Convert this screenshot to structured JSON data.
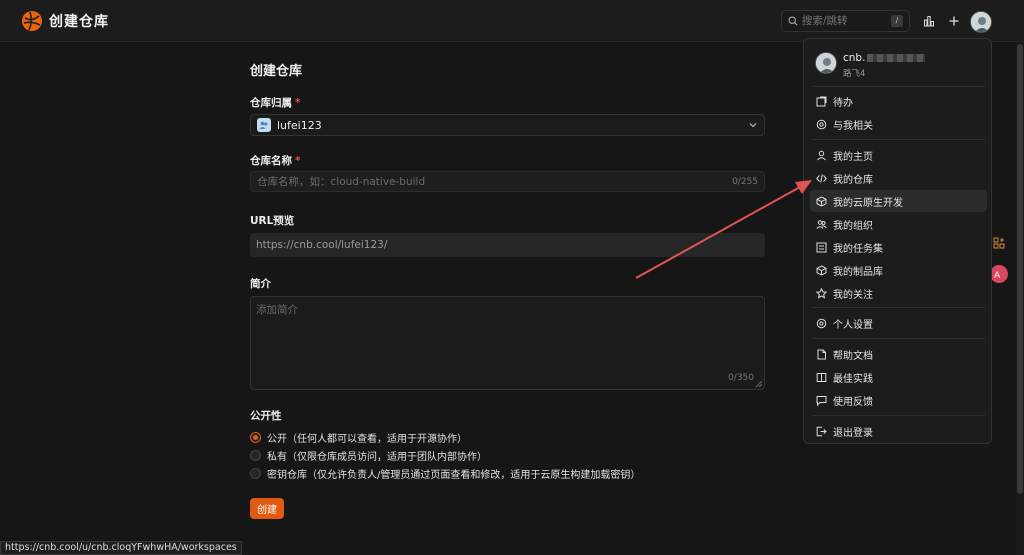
{
  "topbar": {
    "app_title": "创建仓库",
    "search_placeholder": "搜索/跳转",
    "search_shortcut": "/"
  },
  "form": {
    "page_title": "创建仓库",
    "owner_label": "仓库归属",
    "owner_value": "lufei123",
    "name_label": "仓库名称",
    "name_placeholder": "仓库名称，如：cloud-native-build",
    "name_counter": "0/255",
    "url_label": "URL预览",
    "url_value": "https://cnb.cool/lufei123/",
    "desc_label": "简介",
    "desc_placeholder": "添加简介",
    "desc_counter": "0/350",
    "visibility_label": "公开性",
    "visibility_options": [
      {
        "label": "公开（任何人都可以查看，适用于开源协作）",
        "checked": true
      },
      {
        "label": "私有（仅限仓库成员访问，适用于团队内部协作）",
        "checked": false
      },
      {
        "label": "密钥仓库（仅允许负责人/管理员通过页面查看和修改，适用于云原生构建加载密钥）",
        "checked": false
      }
    ],
    "create_button": "创建",
    "required_mark": "*"
  },
  "status_url": "https://cnb.cool/u/cnb.cloqYFwhwHA/workspaces",
  "menu": {
    "user_name": "cnb.",
    "user_sub": "路飞4",
    "items": [
      {
        "label": "待办",
        "icon": "todo-icon"
      },
      {
        "label": "与我相关",
        "icon": "at-icon"
      },
      {
        "label": "我的主页",
        "icon": "user-icon"
      },
      {
        "label": "我的仓库",
        "icon": "code-icon"
      },
      {
        "label": "我的云原生开发",
        "icon": "cube-cloud-icon"
      },
      {
        "label": "我的组织",
        "icon": "group-icon"
      },
      {
        "label": "我的任务集",
        "icon": "list-icon"
      },
      {
        "label": "我的制品库",
        "icon": "package-icon"
      },
      {
        "label": "我的关注",
        "icon": "star-icon"
      },
      {
        "label": "个人设置",
        "icon": "settings-icon"
      },
      {
        "label": "帮助文档",
        "icon": "doc-icon"
      },
      {
        "label": "最佳实践",
        "icon": "book-icon"
      },
      {
        "label": "使用反馈",
        "icon": "feedback-icon"
      },
      {
        "label": "退出登录",
        "icon": "logout-icon"
      }
    ]
  },
  "colors": {
    "accent": "#e05a12",
    "annotation_arrow": "#e05454"
  }
}
